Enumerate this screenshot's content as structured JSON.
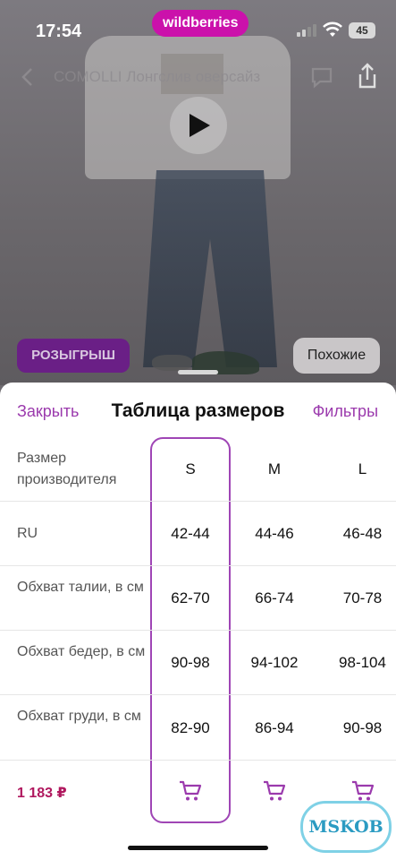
{
  "status_bar": {
    "time": "17:54",
    "brand": "wildberries",
    "battery": "45"
  },
  "product": {
    "title": "COMOLLI Лонгслив оверсайз",
    "raffle_label": "РОЗЫГРЫШ",
    "similar_label": "Похожие"
  },
  "size_table": {
    "close_label": "Закрыть",
    "title": "Таблица размеров",
    "filters_label": "Фильтры",
    "rows": [
      {
        "label": "Размер производителя",
        "values": [
          "S",
          "M",
          "L"
        ]
      },
      {
        "label": "RU",
        "values": [
          "42-44",
          "44-46",
          "46-48"
        ]
      },
      {
        "label": "Обхват талии, в см",
        "values": [
          "62-70",
          "66-74",
          "70-78"
        ]
      },
      {
        "label": "Обхват бедер, в см",
        "values": [
          "90-98",
          "94-102",
          "98-104"
        ]
      },
      {
        "label": "Обхват груди, в см",
        "values": [
          "82-90",
          "86-94",
          "90-98"
        ]
      }
    ],
    "price": "1 183 ₽",
    "selected_size": "S"
  },
  "watermark": "MSKOB",
  "colors": {
    "accent": "#9b3aad",
    "price": "#b0185e",
    "brand": "#cb11ab"
  },
  "icons": [
    "back-icon",
    "chat-icon",
    "share-icon",
    "play-icon",
    "cart-icon",
    "wifi-icon",
    "signal-icon"
  ]
}
